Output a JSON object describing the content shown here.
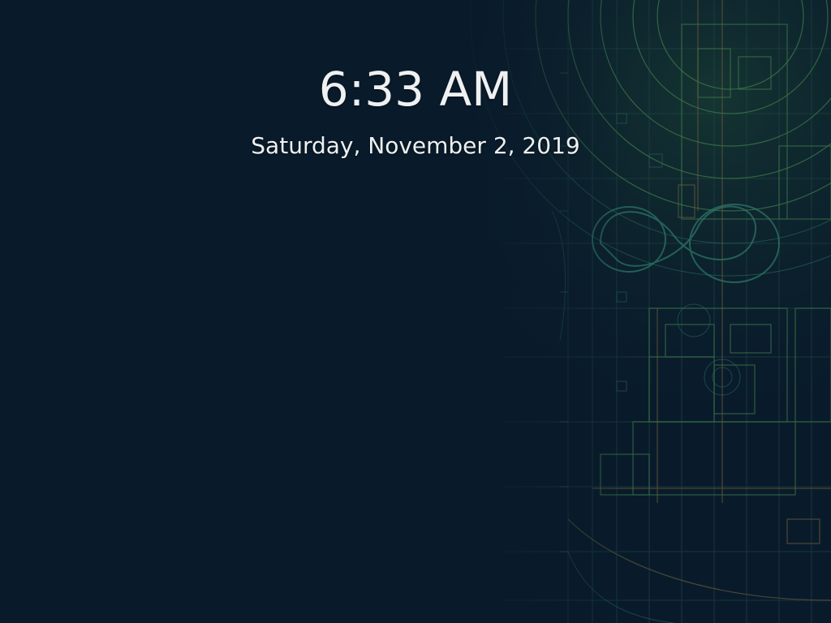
{
  "lockscreen": {
    "time": "6:33 AM",
    "date": "Saturday, November 2, 2019"
  },
  "wallpaper": {
    "description_icon": "blueprint-wallpaper",
    "background_color": "#091b2b",
    "line_color_green": "#3e7a4a",
    "line_color_teal": "#2a6a66",
    "line_color_brown": "#6a5a3a"
  }
}
